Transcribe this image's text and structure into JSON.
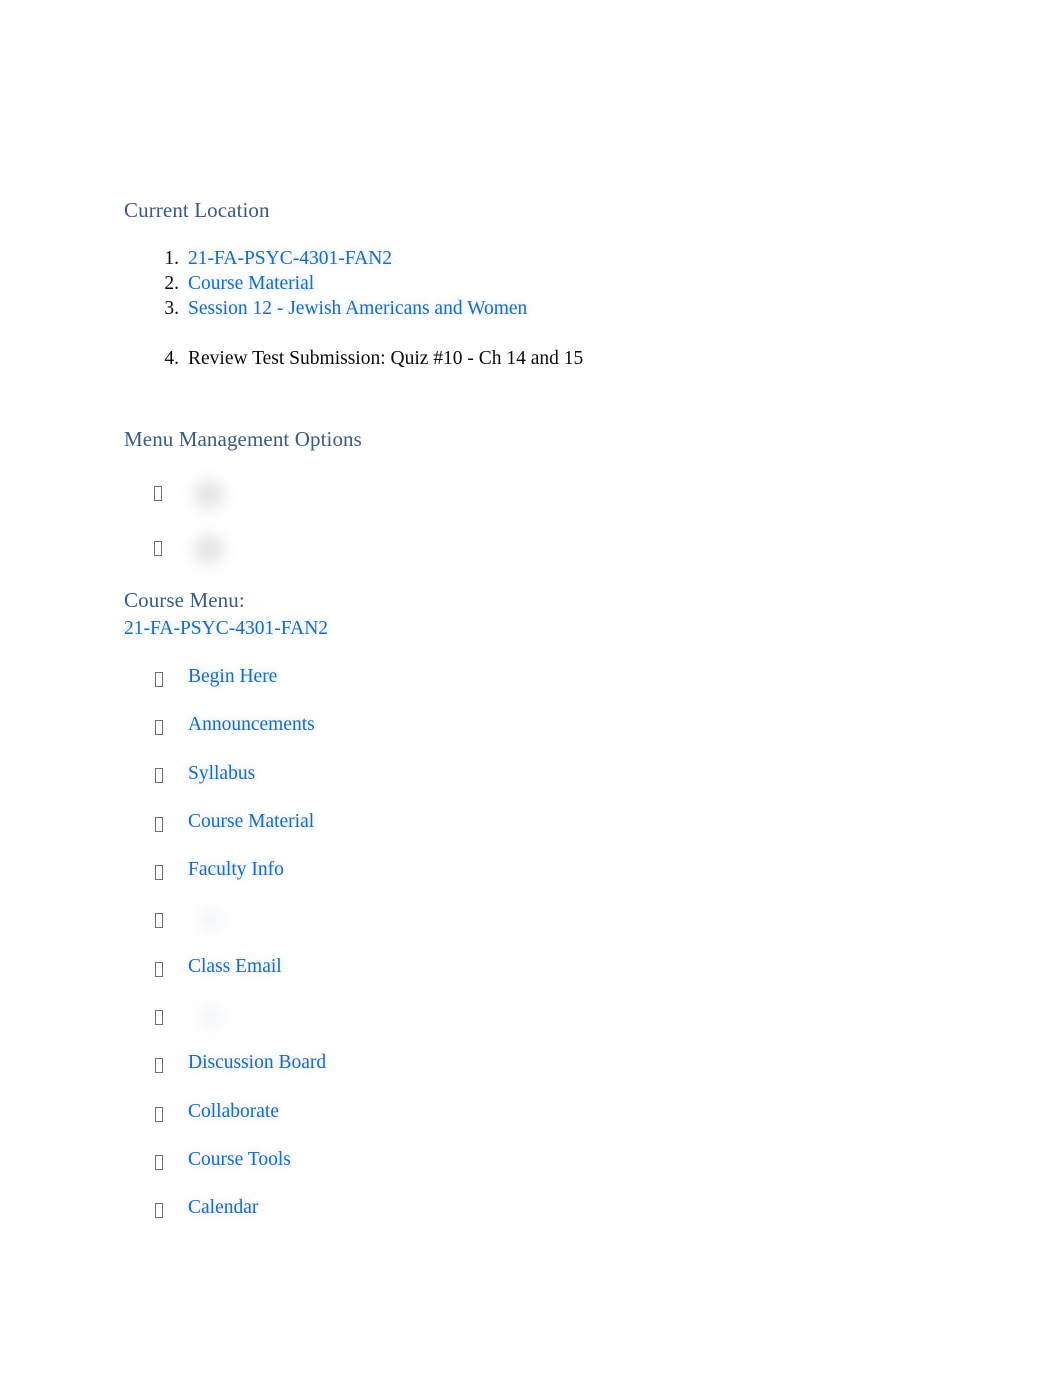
{
  "colors": {
    "heading": "#3a5a85",
    "link": "#1a6bc4",
    "text": "#0a0a0a",
    "background": "#ffffff",
    "bullet_glyph": "#6f6f6f"
  },
  "current_location": {
    "heading": "Current Location",
    "items": [
      {
        "number": "1.",
        "label": "21-FA-PSYC-4301-FAN2",
        "is_link": true
      },
      {
        "number": "2.",
        "label": "Course Material",
        "is_link": true
      },
      {
        "number": "3.",
        "label": "Session 12 - Jewish Americans and Women",
        "is_link": true
      },
      {
        "number": "4.",
        "label": "Review Test Submission: Quiz #10 - Ch 14 and 15",
        "is_link": false
      }
    ]
  },
  "menu_management": {
    "heading": "Menu Management Options",
    "items": [
      {
        "icon": "bullet-missing-glyph-icon",
        "label": ""
      },
      {
        "icon": "bullet-missing-glyph-icon",
        "label": ""
      }
    ]
  },
  "course_menu": {
    "heading": "Course Menu:",
    "course_id": "21-FA-PSYC-4301-FAN2",
    "items": [
      {
        "label": "Begin Here",
        "is_link": true
      },
      {
        "label": "Announcements",
        "is_link": true
      },
      {
        "label": "Syllabus",
        "is_link": true
      },
      {
        "label": "Course Material",
        "is_link": true
      },
      {
        "label": "Faculty Info",
        "is_link": true
      },
      {
        "label": "",
        "is_link": false
      },
      {
        "label": "Class Email",
        "is_link": true
      },
      {
        "label": "",
        "is_link": false
      },
      {
        "label": "Discussion Board",
        "is_link": true
      },
      {
        "label": "Collaborate",
        "is_link": true
      },
      {
        "label": "Course Tools",
        "is_link": true
      },
      {
        "label": "Calendar",
        "is_link": true
      }
    ]
  }
}
